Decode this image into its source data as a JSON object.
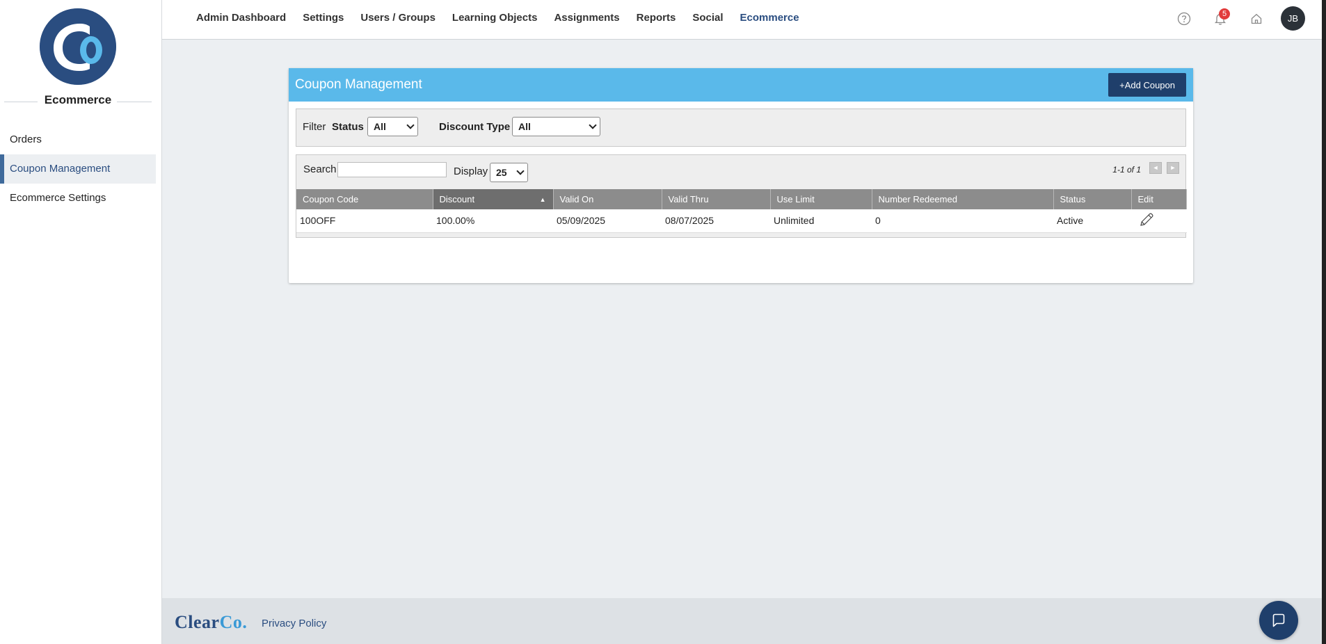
{
  "sidebar": {
    "logo_text": "Co",
    "title": "Ecommerce",
    "items": [
      {
        "label": "Orders"
      },
      {
        "label": "Coupon Management"
      },
      {
        "label": "Ecommerce Settings"
      }
    ]
  },
  "topnav": {
    "items": [
      "Admin Dashboard",
      "Settings",
      "Users / Groups",
      "Learning Objects",
      "Assignments",
      "Reports",
      "Social",
      "Ecommerce"
    ],
    "notification_count": "5",
    "avatar_initials": "JB"
  },
  "page": {
    "title": "Coupon Management",
    "add_button": "+Add Coupon"
  },
  "filter": {
    "label": "Filter",
    "status_label": "Status",
    "status_value": "All",
    "discount_type_label": "Discount Type",
    "discount_type_value": "All"
  },
  "listing": {
    "search_label": "Search",
    "search_value": "",
    "display_label": "Display",
    "display_value": "25",
    "pager_text": "1-1 of 1",
    "prev_glyph": "◄",
    "next_glyph": "►"
  },
  "table": {
    "columns": [
      "Coupon Code",
      "Discount",
      "Valid On",
      "Valid Thru",
      "Use Limit",
      "Number Redeemed",
      "Status",
      "Edit"
    ],
    "sorted_column": "Discount",
    "sort_glyph": "▲",
    "rows": [
      {
        "code": "100OFF",
        "discount": "100.00%",
        "valid_on": "05/09/2025",
        "valid_thru": "08/07/2025",
        "use_limit": "Unlimited",
        "redeemed": "0",
        "status": "Active"
      }
    ]
  },
  "footer": {
    "logo_main": "Clear",
    "logo_accent": "Co.",
    "privacy": "Privacy Policy"
  },
  "colors": {
    "header_blue": "#5ab9ea",
    "navy": "#1f3f6b",
    "brand": "#2a4d80",
    "badge_red": "#e23b3b"
  }
}
